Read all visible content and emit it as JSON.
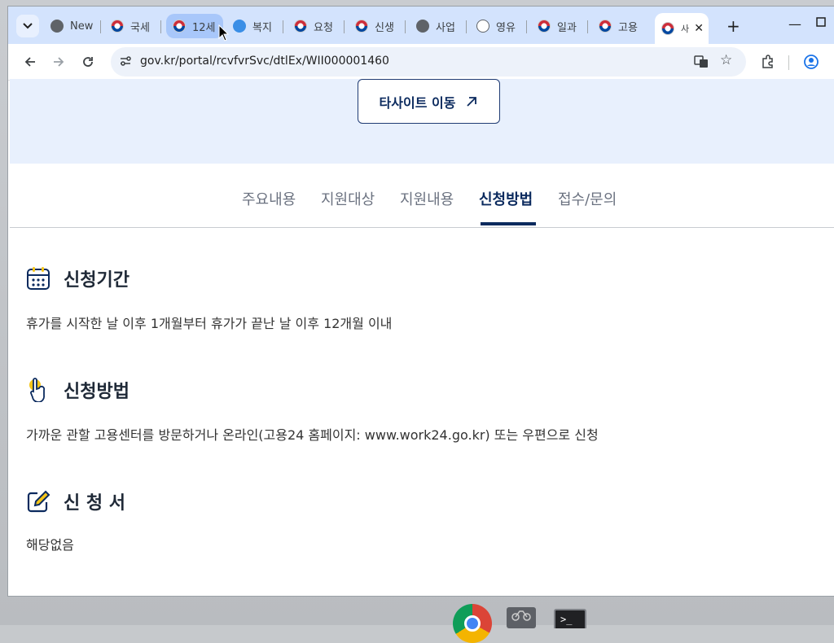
{
  "browser": {
    "tabs": [
      {
        "label": "New",
        "favicon": "chrome-icon"
      },
      {
        "label": "국세",
        "favicon": "korea-gov-icon"
      },
      {
        "label": "12세",
        "favicon": "korea-gov-icon"
      },
      {
        "label": "복지",
        "favicon": "bokji-icon"
      },
      {
        "label": "요청",
        "favicon": "korea-gov-icon"
      },
      {
        "label": "신생",
        "favicon": "korea-gov-icon"
      },
      {
        "label": "사업",
        "favicon": "globe-icon"
      },
      {
        "label": "영유",
        "favicon": "goodwill-icon"
      },
      {
        "label": "일과",
        "favicon": "korea-gov-icon"
      },
      {
        "label": "고용",
        "favicon": "korea-gov-icon"
      },
      {
        "label": "사",
        "favicon": "korea-gov-icon"
      }
    ],
    "url": "gov.kr/portal/rcvfvrSvc/dtlEx/WII000001460"
  },
  "page": {
    "site_button": "타사이트 이동",
    "tabs": [
      "주요내용",
      "지원대상",
      "지원내용",
      "신청방법",
      "접수/문의"
    ],
    "active_tab": "신청방법",
    "sections": [
      {
        "title": "신청기간",
        "icon": "calendar-icon",
        "text": "휴가를 시작한 날 이후 1개월부터 휴가가 끝난 날 이후 12개월 이내"
      },
      {
        "title": "신청방법",
        "icon": "pointer-hand-icon",
        "text": "가까운 관할 고용센터를 방문하거나 온라인(고용24 홈페이지: www.work24.go.kr) 또는 우편으로 신청"
      },
      {
        "title": "신 청 서",
        "icon": "edit-icon",
        "text": "해당없음"
      }
    ]
  },
  "taskbar": {
    "terminal_label": ">_"
  },
  "colors": {
    "accent": "#0b2a5e",
    "hero_bg": "#e8f0fd",
    "tabstrip_bg": "#d3e3fd"
  }
}
